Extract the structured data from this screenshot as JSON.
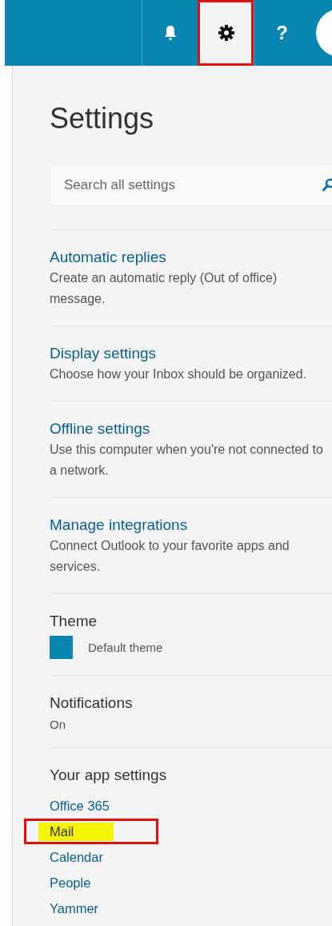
{
  "header": {
    "buttons": [
      {
        "kind": "bell",
        "selected": false,
        "annotated": false
      },
      {
        "kind": "gear",
        "selected": true,
        "annotated": true
      },
      {
        "kind": "help",
        "label": "?",
        "selected": false,
        "annotated": false
      }
    ]
  },
  "settings": {
    "title": "Settings",
    "search": {
      "placeholder": "Search all settings"
    },
    "links": [
      {
        "title": "Automatic replies",
        "description": "Create an automatic reply (Out of office) message."
      },
      {
        "title": "Display settings",
        "description": "Choose how your Inbox should be organized."
      },
      {
        "title": "Offline settings",
        "description": "Use this computer when you're not connected to a network."
      },
      {
        "title": "Manage integrations",
        "description": "Connect Outlook to your favorite apps and services."
      }
    ],
    "theme": {
      "label": "Theme",
      "value": "Default theme",
      "color": "#0a84b0"
    },
    "notifications": {
      "label": "Notifications",
      "value": "On"
    },
    "app_settings": {
      "heading": "Your app settings",
      "items": [
        {
          "label": "Office 365",
          "highlighted": false,
          "annotated": false
        },
        {
          "label": "Mail",
          "highlighted": true,
          "annotated": true
        },
        {
          "label": "Calendar",
          "highlighted": false,
          "annotated": false
        },
        {
          "label": "People",
          "highlighted": false,
          "annotated": false
        },
        {
          "label": "Yammer",
          "highlighted": false,
          "annotated": false
        }
      ]
    }
  }
}
